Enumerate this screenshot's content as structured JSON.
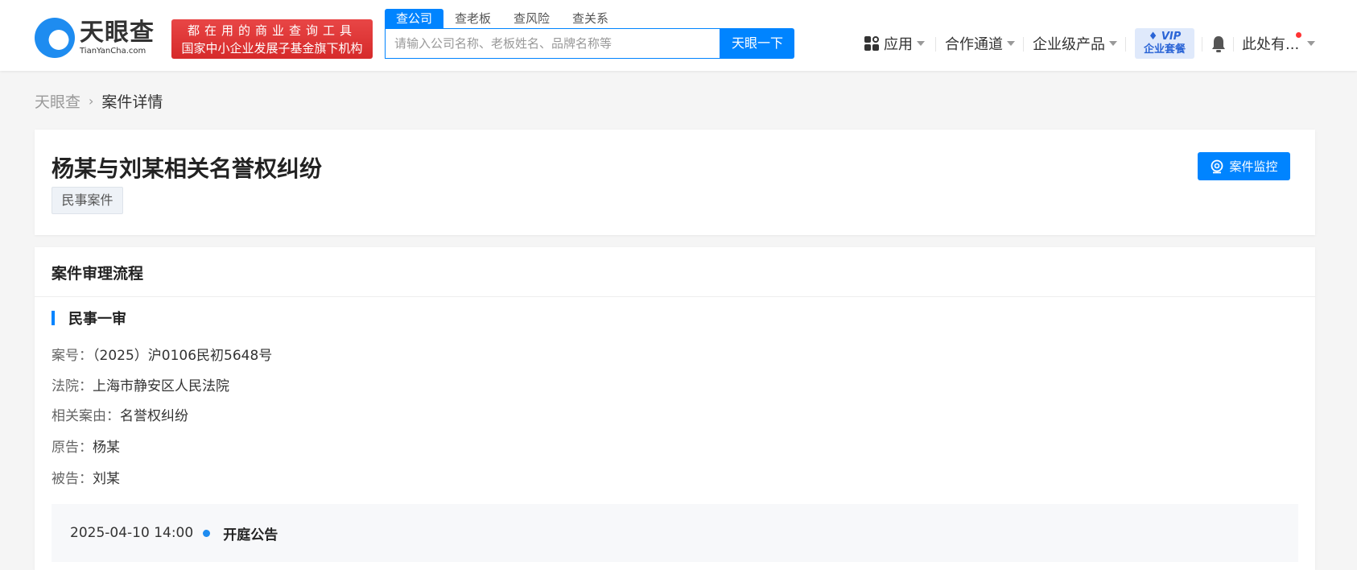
{
  "header": {
    "logo": {
      "cn": "天眼查",
      "en": "TianYanCha.com"
    },
    "banner": {
      "line1": "都在用的商业查询工具",
      "line2": "国家中小企业发展子基金旗下机构"
    },
    "search": {
      "tabs": [
        {
          "label": "查公司",
          "active": true
        },
        {
          "label": "查老板"
        },
        {
          "label": "查风险"
        },
        {
          "label": "查关系"
        }
      ],
      "placeholder": "请输入公司名称、老板姓名、品牌名称等",
      "button": "天眼一下"
    },
    "nav": {
      "apps": "应用",
      "partner": "合作通道",
      "enterprise": "企业级产品",
      "vip_top": "VIP",
      "vip_bottom": "企业套餐",
      "user": "此处有..."
    },
    "colors": {
      "accent": "#0084ff",
      "banner": "#e03a3a",
      "notify_dot": "#ff3333"
    }
  },
  "breadcrumb": {
    "home": "天眼查",
    "current": "案件详情"
  },
  "case": {
    "title": "杨某与刘某相关名誉权纠纷",
    "tag": "民事案件",
    "monitor_button": "案件监控"
  },
  "process": {
    "section_title": "案件审理流程",
    "stage": "民事一审",
    "fields": [
      {
        "label": "案号：",
        "value": "（2025）沪0106民初5648号"
      },
      {
        "label": "法院：",
        "value": "上海市静安区人民法院"
      },
      {
        "label": "相关案由：",
        "value": "名誉权纠纷"
      },
      {
        "label": "原告：",
        "value": "杨某"
      },
      {
        "label": "被告：",
        "value": "刘某"
      }
    ],
    "events": [
      {
        "time": "2025-04-10 14:00",
        "title": "开庭公告"
      }
    ]
  }
}
